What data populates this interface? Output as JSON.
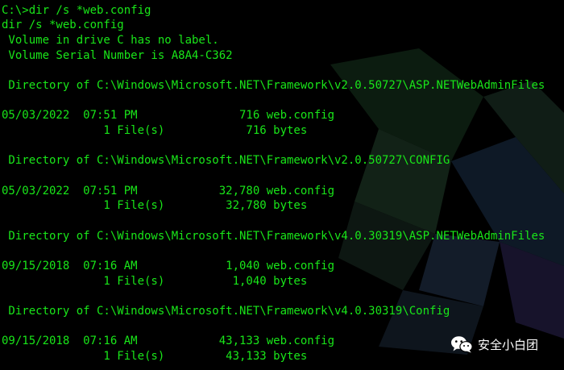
{
  "terminal": {
    "lines": [
      "C:\\>dir /s *web.config",
      "dir /s *web.config",
      " Volume in drive C has no label.",
      " Volume Serial Number is A8A4-C362",
      "",
      " Directory of C:\\Windows\\Microsoft.NET\\Framework\\v2.0.50727\\ASP.NETWebAdminFiles",
      "",
      "05/03/2022  07:51 PM               716 web.config",
      "               1 File(s)            716 bytes",
      "",
      " Directory of C:\\Windows\\Microsoft.NET\\Framework\\v2.0.50727\\CONFIG",
      "",
      "05/03/2022  07:51 PM            32,780 web.config",
      "               1 File(s)         32,780 bytes",
      "",
      " Directory of C:\\Windows\\Microsoft.NET\\Framework\\v4.0.30319\\ASP.NETWebAdminFiles",
      "",
      "09/15/2018  07:16 AM             1,040 web.config",
      "               1 File(s)          1,040 bytes",
      "",
      " Directory of C:\\Windows\\Microsoft.NET\\Framework\\v4.0.30319\\Config",
      "",
      "09/15/2018  07:16 AM            43,133 web.config",
      "               1 File(s)         43,133 bytes"
    ]
  },
  "watermark": {
    "icon": "wechat-icon",
    "text": "安全小白团"
  },
  "colors": {
    "background": "#000000",
    "text": "#19e619",
    "watermark": "#ffffff"
  }
}
